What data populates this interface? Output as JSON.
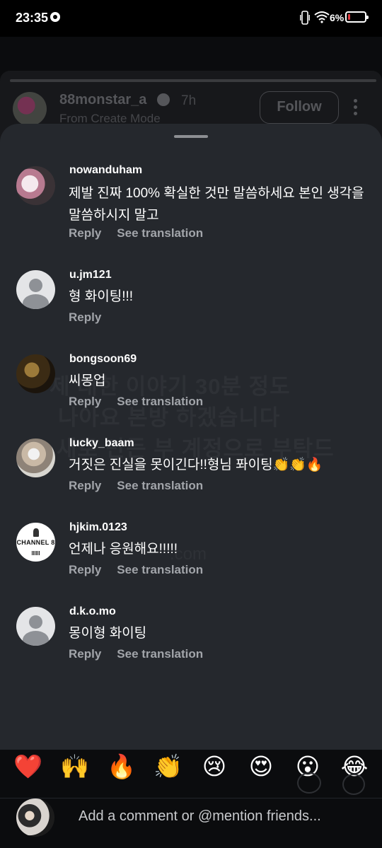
{
  "status_bar": {
    "time": "23:35",
    "battery_percent": "6%",
    "battery_color": "#e0393e"
  },
  "post": {
    "username": "88monstar_a",
    "time": "7h",
    "subtitle": "From Create Mode",
    "follow_label": "Follow"
  },
  "ghost_text": {
    "line1": "제 대한 이야기 30분 정도",
    "line2": "나아요 본방 하겠습니다",
    "line3": "새로 만든 부 계정으로 부탁드",
    "line4": ".com"
  },
  "comments": [
    {
      "username": "nowanduham",
      "text": "제발 진짜 100% 확실한 것만 말씀하세요 본인 생각을 말씀하시지 말고",
      "reply": "Reply",
      "translate": "See translation"
    },
    {
      "username": "u.jm121",
      "text": "형 화이팅!!!",
      "reply": "Reply"
    },
    {
      "username": "bongsoon69",
      "text": "씨몽업",
      "reply": "Reply",
      "translate": "See translation"
    },
    {
      "username": "lucky_baam",
      "text": "거짓은 진실을 못이긴다!!형님 퐈이팅👏👏🔥",
      "reply": "Reply",
      "translate": "See translation"
    },
    {
      "username": "hjkim.0123",
      "text": "언제나 응원해요!!!!!",
      "reply": "Reply",
      "translate": "See translation",
      "avatar_text": "CHANNEL 8"
    },
    {
      "username": "d.k.o.mo",
      "text": "몽이형 화이팅",
      "reply": "Reply",
      "translate": "See translation"
    }
  ],
  "emojis": [
    "❤️",
    "🙌",
    "🔥",
    "👏",
    "😢",
    "😍",
    "😮",
    "😂"
  ],
  "composer": {
    "placeholder": "Add a comment or @mention friends..."
  }
}
